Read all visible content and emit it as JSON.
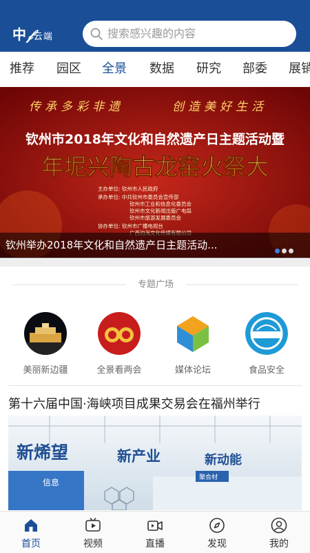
{
  "header": {
    "logo_text": "中",
    "logo_sub": "云端",
    "search_placeholder": "搜索感兴趣的内容"
  },
  "tabs": [
    {
      "label": "推荐",
      "active": false
    },
    {
      "label": "园区",
      "active": false
    },
    {
      "label": "全景",
      "active": true
    },
    {
      "label": "数据",
      "active": false
    },
    {
      "label": "研究",
      "active": false
    },
    {
      "label": "部委",
      "active": false
    },
    {
      "label": "展销",
      "active": false
    }
  ],
  "banner": {
    "slogan_left": "传承多彩非遗",
    "slogan_right": "创造美好生活",
    "headline1": "钦州市2018年文化和自然遗产日主题活动暨",
    "headline2": "年坭兴陶古龙窑火祭大",
    "info_lines": [
      "主办单位:  钦州市人民政府",
      "承办单位:  中共钦州市委员会宣传部",
      "钦州市工业和信息化委员会",
      "钦州市文化新闻出版广电局",
      "钦州市旅游发展委员会",
      "协办单位:  钦州市广播电视台",
      "广西泊海文化传媒有限公司"
    ],
    "caption": "钦州举办2018年文化和自然遗产日主题活动...",
    "slide_count": 3,
    "active_slide": 1
  },
  "section": {
    "title": "专题广场",
    "features": [
      {
        "label": "美丽新边疆"
      },
      {
        "label": "全景看两会"
      },
      {
        "label": "媒体论坛"
      },
      {
        "label": "食品安全"
      }
    ]
  },
  "news": {
    "title": "第十六届中国·海峡项目成果交易会在福州举行",
    "image_text": [
      "新烯望",
      "新产业",
      "新动能",
      "信息",
      "聚合材"
    ]
  },
  "bottom_nav": [
    {
      "label": "首页",
      "icon": "home-icon",
      "active": true
    },
    {
      "label": "视频",
      "icon": "tv-icon",
      "active": false
    },
    {
      "label": "直播",
      "icon": "camera-icon",
      "active": false
    },
    {
      "label": "发现",
      "icon": "compass-icon",
      "active": false
    },
    {
      "label": "我的",
      "icon": "user-icon",
      "active": false
    }
  ],
  "colors": {
    "brand": "#1a4f97",
    "banner_red": "#8d0b0b",
    "dot_active": "#3b7fe0"
  }
}
